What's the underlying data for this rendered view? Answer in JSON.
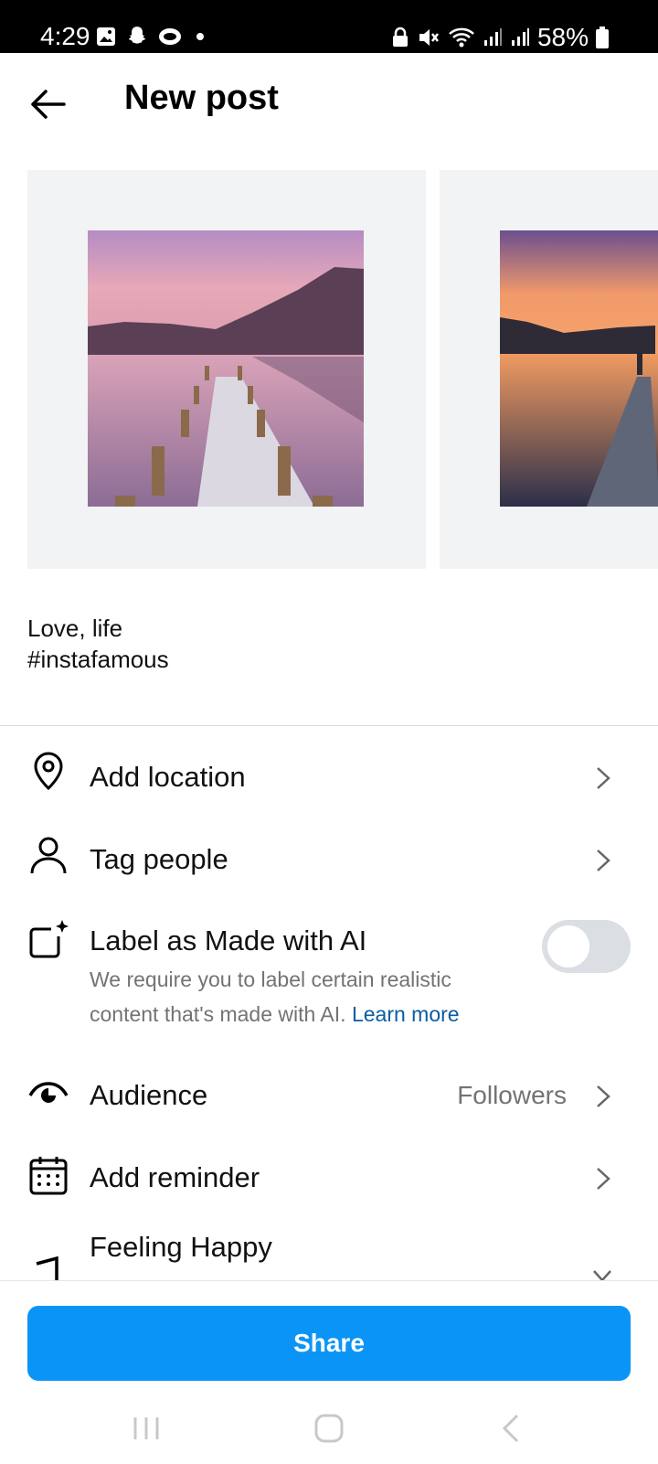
{
  "status_bar": {
    "time": "4:29",
    "battery": "58%"
  },
  "header": {
    "title": "New post"
  },
  "caption": {
    "line1": "Love, life",
    "line2": "#instafamous"
  },
  "rows": {
    "location": "Add location",
    "tag_people": "Tag people",
    "ai_label": "Label as Made with AI",
    "ai_subtext": "We require you to label certain realistic content that's made with AI.",
    "ai_learn_more": "Learn more",
    "ai_toggle_on": false,
    "audience": "Audience",
    "audience_value": "Followers",
    "reminder": "Add reminder",
    "feeling": "Feeling Happy"
  },
  "share_button": "Share",
  "colors": {
    "accent": "#0a95f6",
    "link": "#0a5ca3",
    "muted": "#737373"
  }
}
